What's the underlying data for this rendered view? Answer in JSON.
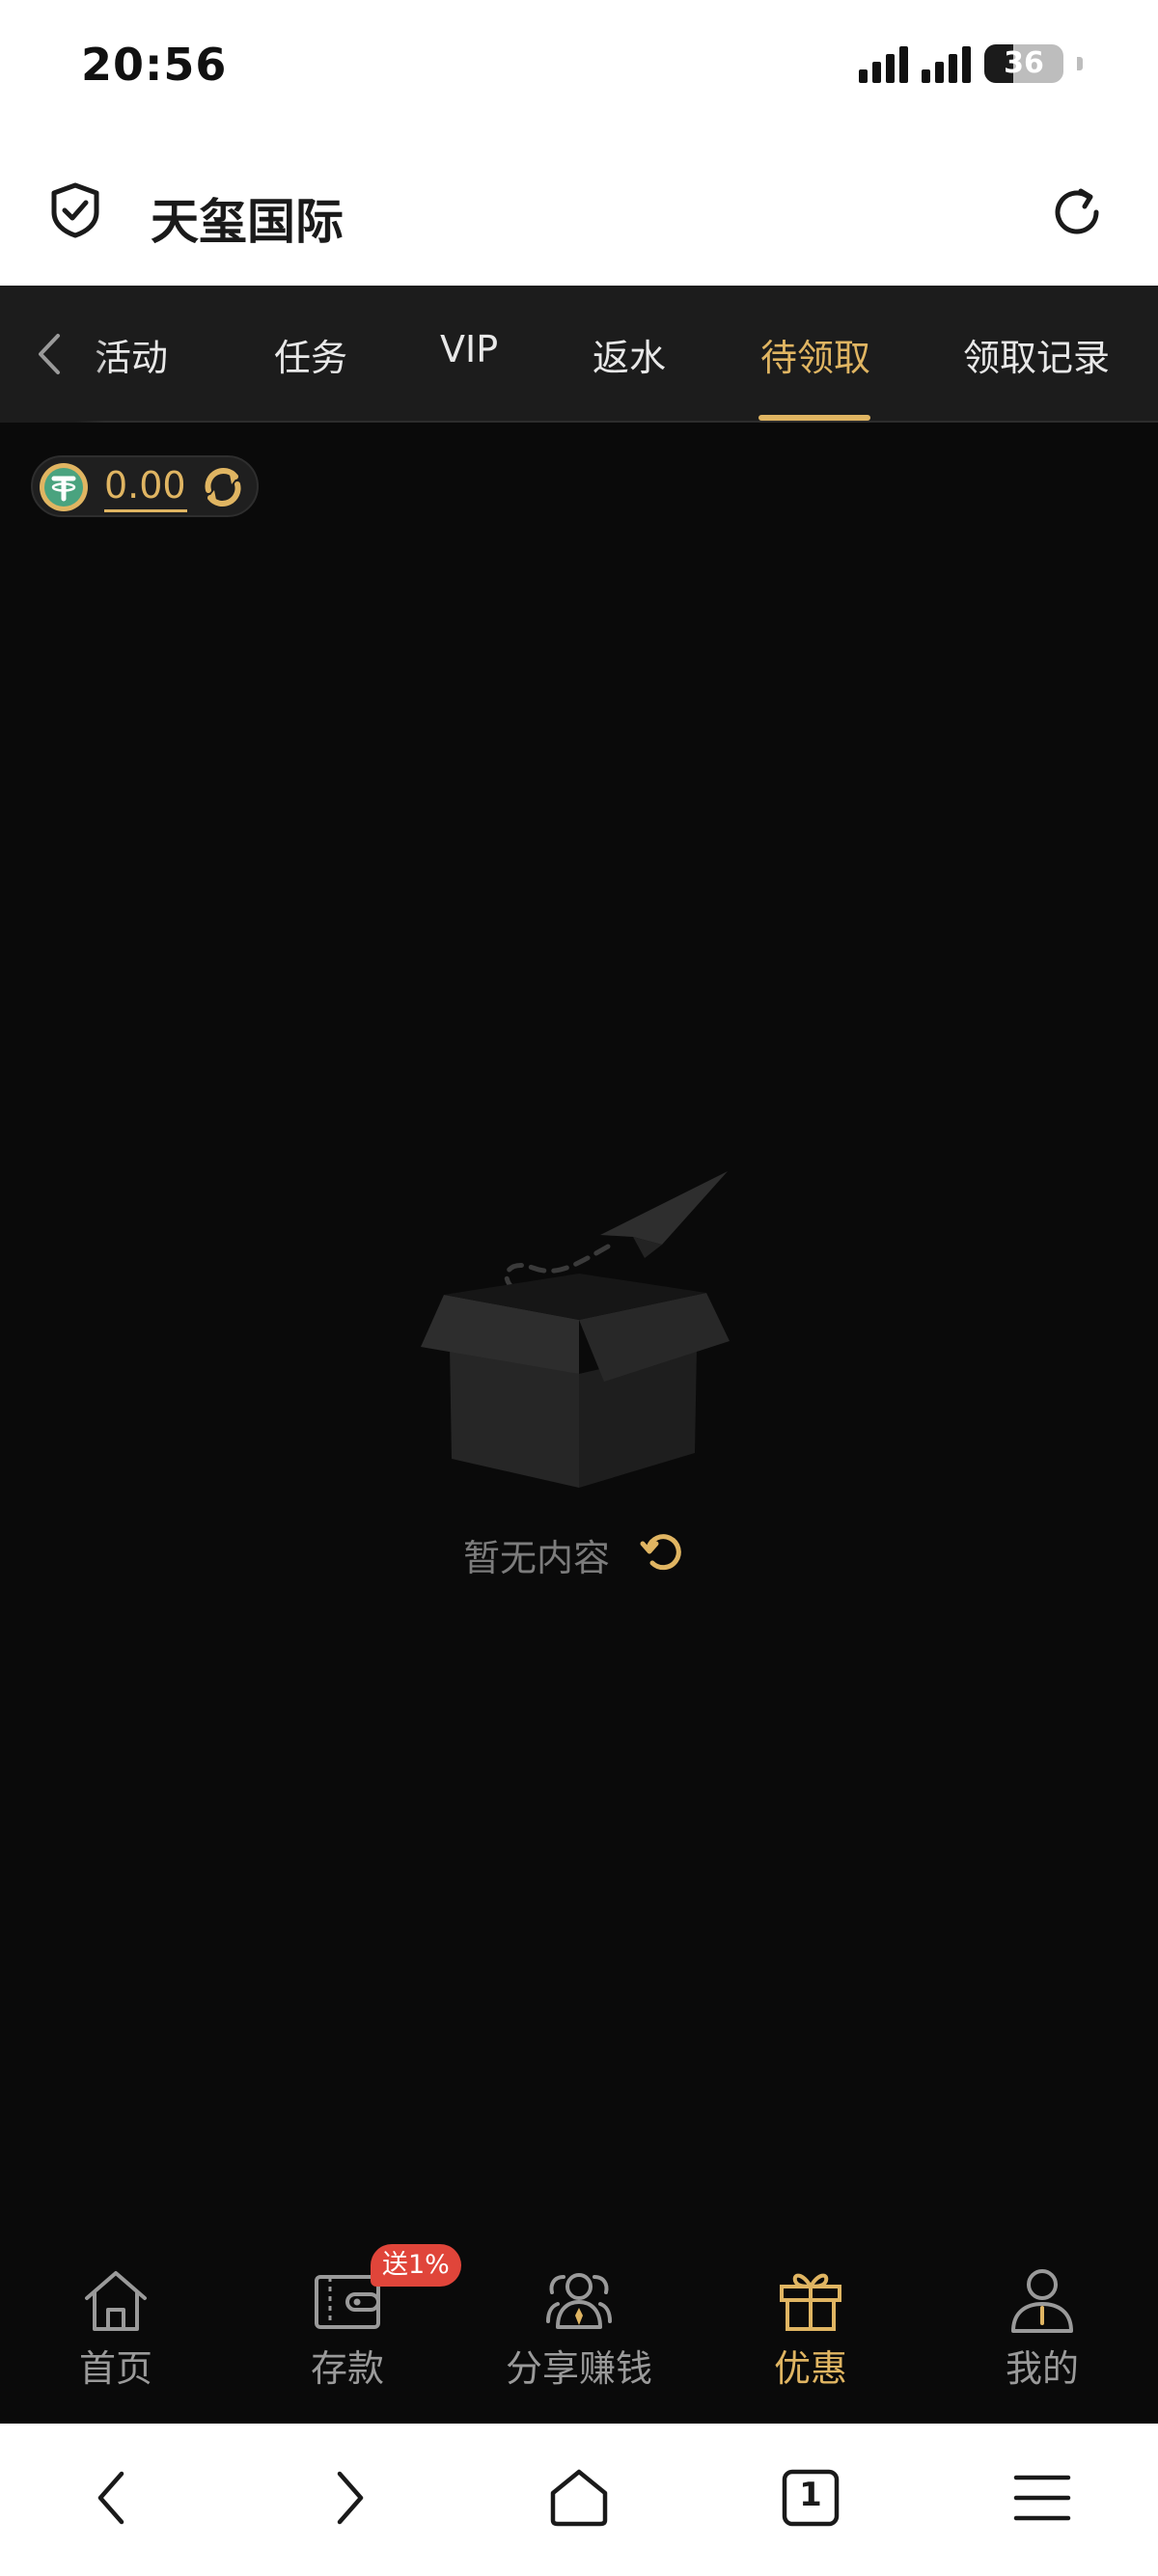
{
  "status_bar": {
    "time": "20:56",
    "battery": "36",
    "battery_level": 0.36
  },
  "header": {
    "title": "天玺国际"
  },
  "tabs": [
    {
      "label": "活动",
      "active": false
    },
    {
      "label": "任务",
      "active": false
    },
    {
      "label": "VIP",
      "active": false
    },
    {
      "label": "返水",
      "active": false
    },
    {
      "label": "待领取",
      "active": true
    },
    {
      "label": "领取记录",
      "active": false
    }
  ],
  "balance": {
    "value": "0.00",
    "currency_icon": "usdt-icon"
  },
  "empty_state": {
    "text": "暂无内容"
  },
  "bottom_nav": {
    "items": [
      {
        "label": "首页",
        "icon": "home-icon",
        "active": false
      },
      {
        "label": "存款",
        "icon": "wallet-icon",
        "active": false
      },
      {
        "label": "分享赚钱",
        "icon": "share-users-icon",
        "active": false
      },
      {
        "label": "优惠",
        "icon": "gift-icon",
        "active": true
      },
      {
        "label": "我的",
        "icon": "profile-icon",
        "active": false
      }
    ],
    "deposit_badge": "送1%"
  },
  "browser_bar": {
    "tab_count": "1"
  },
  "colors": {
    "accent": "#e0b562",
    "background": "#0a0a0a",
    "tab_bar": "#1c1c1c",
    "badge": "#e0453a",
    "usdt": "#4aa37f"
  }
}
